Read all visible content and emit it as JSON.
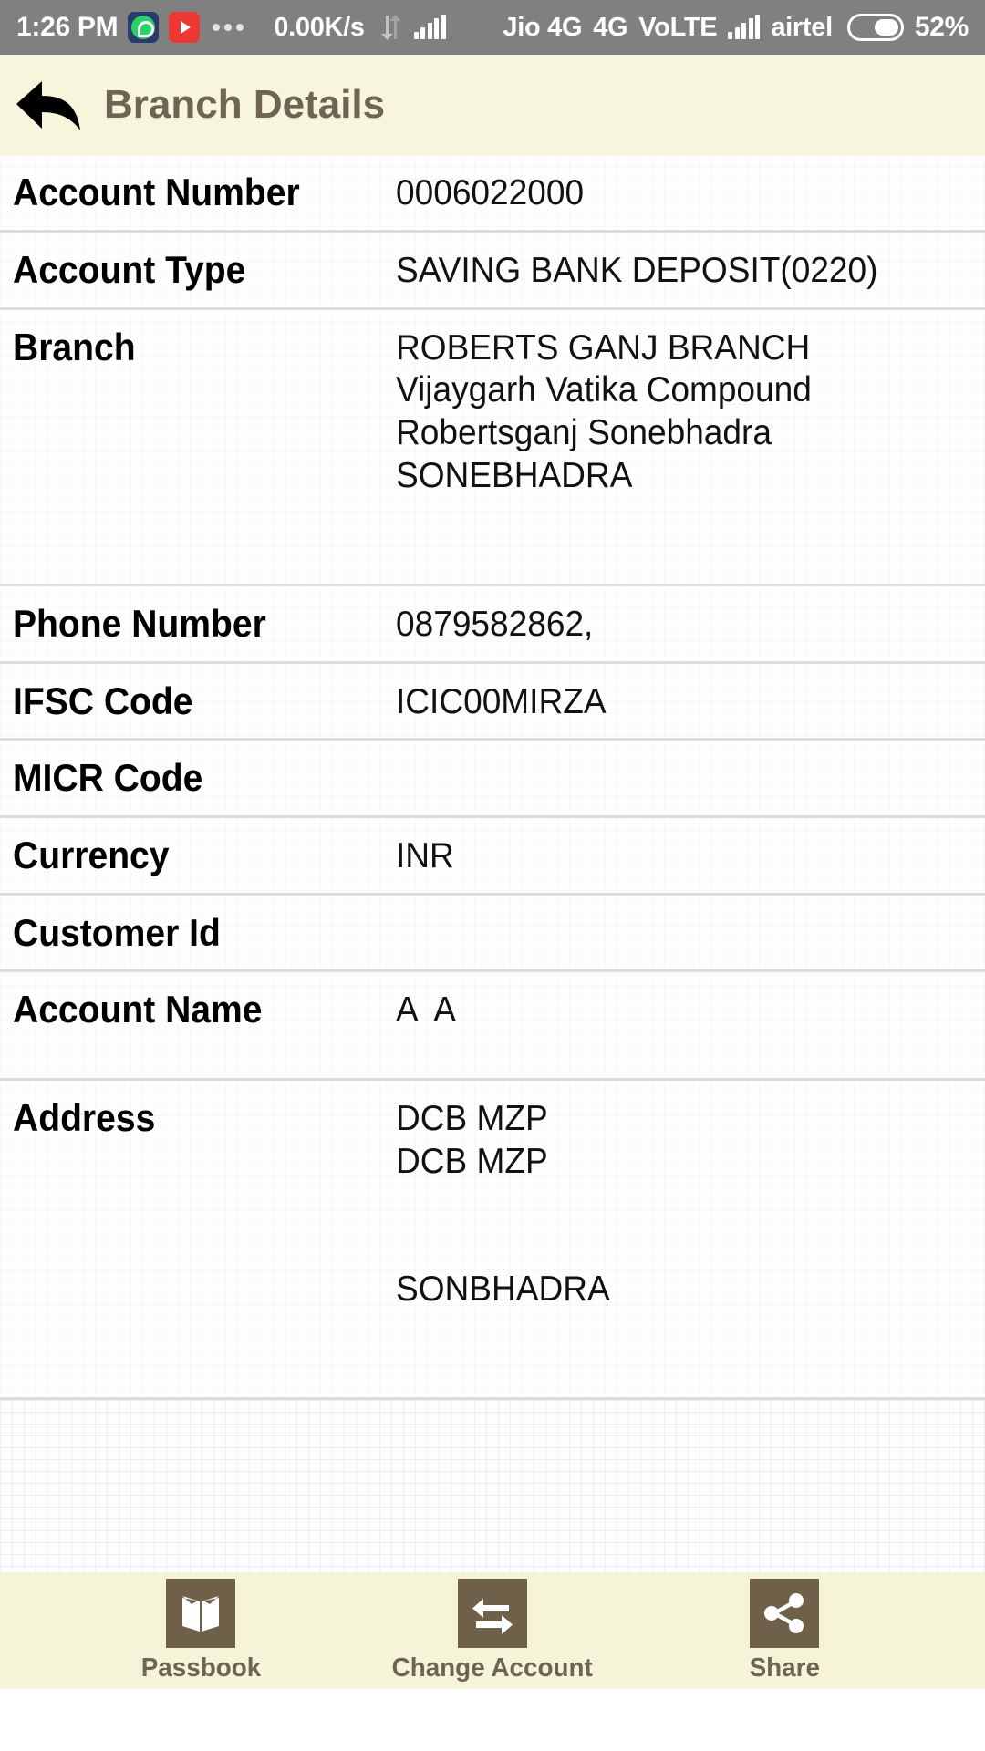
{
  "status_bar": {
    "time": "1:26 PM",
    "app_icons": [
      "whatsapp-icon",
      "youtube-icon",
      "overflow-dots-icon"
    ],
    "network_speed": "0.00K/s",
    "sync_icon": "data-transfer-icon",
    "sim1_signal_icon": "signal-bars-icon",
    "sim1_carrier": "Jio 4G",
    "network_type": "4G",
    "volte": "VoLTE",
    "sim2_signal_icon": "signal-bars-icon",
    "sim2_carrier": "airtel",
    "battery_icon": "battery-icon",
    "battery_percent": "52%"
  },
  "header": {
    "back_icon": "back-arrow-icon",
    "title": "Branch Details"
  },
  "details": {
    "rows": [
      {
        "label": "Account Number",
        "lines": [
          "0006022000"
        ]
      },
      {
        "label": "Account Type",
        "lines": [
          "SAVING BANK DEPOSIT(0220)"
        ]
      },
      {
        "label": "Branch",
        "lines": [
          "ROBERTS GANJ BRANCH",
          "Vijaygarh Vatika Compound",
          "Robertsganj Sonebhadra",
          "SONEBHADRA"
        ],
        "trailing_gap": true
      },
      {
        "label": "Phone Number",
        "lines": [
          "0879582862,"
        ]
      },
      {
        "label": "IFSC Code",
        "lines": [
          "ICIC00MIRZA"
        ]
      },
      {
        "label": "MICR Code",
        "lines": []
      },
      {
        "label": "Currency",
        "lines": [
          "INR"
        ]
      },
      {
        "label": "Customer Id",
        "lines": []
      },
      {
        "label": "Account Name",
        "lines": [
          "A  A"
        ],
        "trailing_gap_small": true
      },
      {
        "label": "Address",
        "lines": [
          "DCB MZP",
          "DCB MZP",
          "",
          "",
          "SONBHADRA"
        ],
        "trailing_gap": true
      }
    ]
  },
  "bottom_nav": {
    "items": [
      {
        "label": "Passbook",
        "icon": "passbook-book-icon"
      },
      {
        "label": "Change Account",
        "icon": "swap-arrows-icon"
      },
      {
        "label": "Share",
        "icon": "share-nodes-icon"
      }
    ]
  },
  "colors": {
    "status_bar_bg": "#808080",
    "header_bg": "#F7F5DC",
    "header_title": "#6F6454",
    "nav_tile": "#6E6049",
    "divider": "#dcdcdc"
  }
}
